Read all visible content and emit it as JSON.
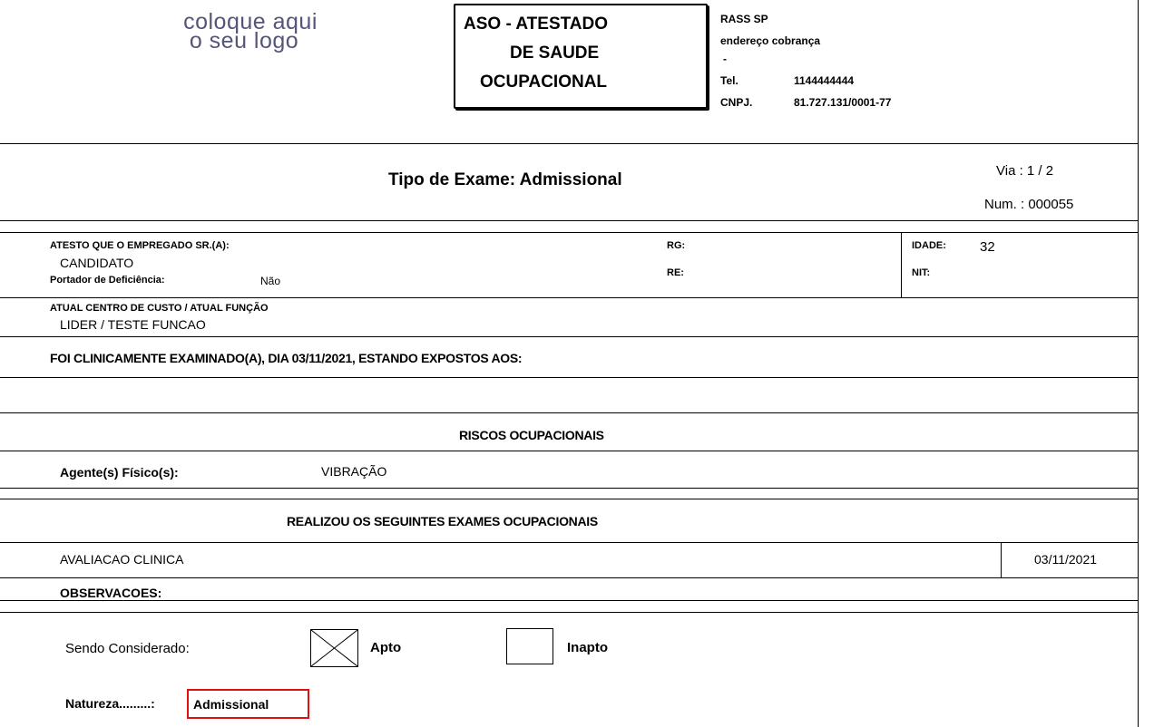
{
  "header": {
    "logo_line1": "coloque aqui",
    "logo_line2": "o seu logo",
    "title_line1": "ASO - ATESTADO",
    "title_line2": "DE SAUDE",
    "title_line3": "OCUPACIONAL",
    "company_name": "RASS SP",
    "company_address": "endereço cobrança",
    "company_dash": "-",
    "tel_label": "Tel.",
    "tel_value": "1144444444",
    "cnpj_label": "CNPJ.",
    "cnpj_value": "81.727.131/0001-77"
  },
  "exam": {
    "tipo": "Tipo de Exame: Admissional",
    "via": "Via :  1 / 2",
    "num": "Num. : 000055"
  },
  "employee": {
    "atesto_label": "ATESTO QUE O EMPREGADO SR.(A):",
    "name": "CANDIDATO",
    "deficiencia_label": "Portador de Deficiência:",
    "deficiencia_value": "Não",
    "rg_label": "RG:",
    "re_label": "RE:",
    "idade_label": "IDADE:",
    "idade_value": "32",
    "nit_label": "NIT:",
    "centro_label": "ATUAL CENTRO DE CUSTO / ATUAL FUNÇÃO",
    "centro_value": "LIDER / TESTE FUNCAO",
    "examinado": "FOI CLINICAMENTE EXAMINADO(A), DIA 03/11/2021,  ESTANDO EXPOSTOS AOS:"
  },
  "riscos": {
    "header": "RISCOS OCUPACIONAIS",
    "agente_label": "Agente(s) Físico(s):",
    "agente_value": "VIBRAÇÃO"
  },
  "exames": {
    "header": "REALIZOU OS SEGUINTES EXAMES OCUPACIONAIS",
    "items": [
      {
        "name": "AVALIACAO CLINICA",
        "date": "03/11/2021"
      }
    ],
    "observacoes_label": "OBSERVACOES:"
  },
  "conclusion": {
    "sendo_label": "Sendo Considerado:",
    "apto_label": "Apto",
    "apto_checked": true,
    "inapto_label": "Inapto",
    "inapto_checked": false,
    "natureza_label": "Natureza.........:",
    "natureza_value": "Admissional"
  }
}
